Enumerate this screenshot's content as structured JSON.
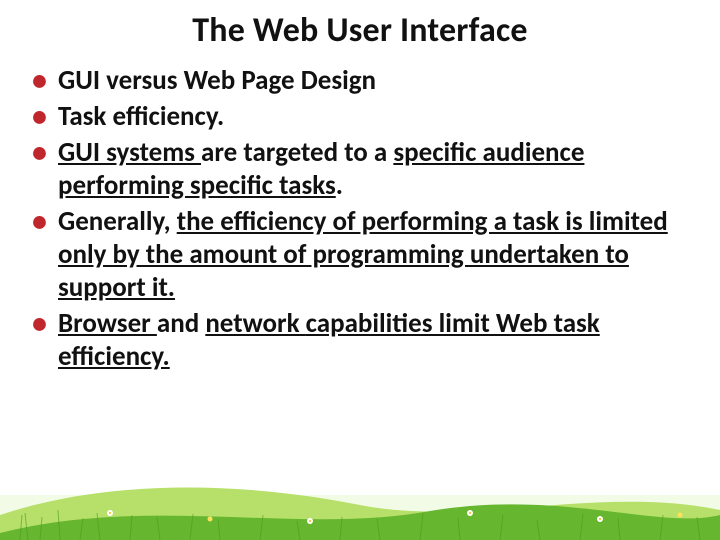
{
  "slide": {
    "title": "The Web User Interface",
    "bullets": [
      {
        "html": "GUI versus Web Page Design"
      },
      {
        "html": "Task efficiency."
      },
      {
        "html": "<span class=\"u\">GUI systems </span>are targeted to a <span class=\"u\">specific audience performing specific tasks</span>."
      },
      {
        "html": "Generally, <span class=\"u\">the efficiency of performing a task is limited only </span><span class=\"u\">by the amount of programming undertaken to support it.</span>"
      },
      {
        "html": "<span class=\"u\">Browser </span>and <span class=\"u\">network </span><span class=\"u\">capabilities limit Web task efficiency.</span>"
      }
    ],
    "theme": {
      "accent": "#c0272d",
      "grass_light": "#b6e06a",
      "grass_dark": "#5aa51e",
      "sky": "#e8f6d8"
    }
  }
}
